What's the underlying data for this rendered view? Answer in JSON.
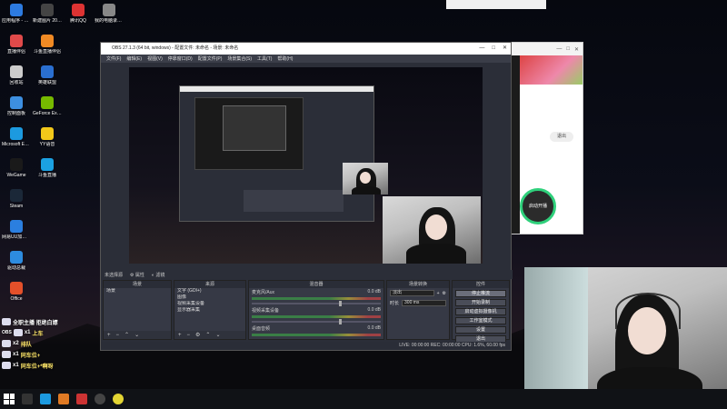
{
  "desktop": {
    "icons": [
      {
        "label": "应用程序 - 快捷方式",
        "color": "#2d7be0"
      },
      {
        "label": "新建图片 20210...",
        "color": "#444"
      },
      {
        "label": "腾讯QQ",
        "color": "#d33"
      },
      {
        "label": "我的电脑录屏 截屏",
        "color": "#888"
      },
      {
        "label": "直播伴侣",
        "color": "#e04a4a"
      },
      {
        "label": "斗鱼直播伴侣",
        "color": "#f08a24"
      },
      {
        "label": "回收站",
        "color": "#ccc"
      },
      {
        "label": "英雄联盟",
        "color": "#2a6fd0"
      },
      {
        "label": "控制面板",
        "color": "#3d8fe0"
      },
      {
        "label": "GeForce Experience",
        "color": "#76b900"
      },
      {
        "label": "Microsoft Edge",
        "color": "#1c9ae0"
      },
      {
        "label": "YY语音",
        "color": "#f2c81a"
      },
      {
        "label": "WeGame",
        "color": "#1a1a1a"
      },
      {
        "label": "斗鱼直播",
        "color": "#1ba1e2"
      },
      {
        "label": "Steam",
        "color": "#1b2838"
      },
      {
        "label": "网易UU加速器",
        "color": "#2b7fe0"
      },
      {
        "label": "驱动总裁",
        "color": "#2d8ce0"
      },
      {
        "label": "Office",
        "color": "#e3502a"
      }
    ]
  },
  "bg_app": {
    "close_label": "退出",
    "circle_label": "启动开播"
  },
  "obs": {
    "title": "OBS 27.1.3 (64 bit, windows) - 配置文件: 未命名 - 场景: 未命名",
    "menu": [
      "文件(F)",
      "编辑(E)",
      "视图(V)",
      "停靠窗口(D)",
      "配置文件(P)",
      "场景集合(S)",
      "工具(T)",
      "帮助(H)"
    ],
    "small_bar": {
      "no_source": "未选择源",
      "props": "属性",
      "filters": "滤镜"
    },
    "docks": {
      "scenes": {
        "title": "场景",
        "items": [
          "场景"
        ]
      },
      "sources": {
        "title": "来源",
        "items": [
          "文字 (GDI+)",
          "图像",
          "视频采集设备",
          "显示器采集"
        ]
      },
      "mixer": {
        "title": "混音器",
        "channels": [
          {
            "name": "麦克风/Aux",
            "db": "0.0 dB"
          },
          {
            "name": "视频采集设备",
            "db": "0.0 dB"
          },
          {
            "name": "桌面音频",
            "db": "0.0 dB"
          }
        ]
      },
      "transitions": {
        "title": "场景转换",
        "type": "淡出",
        "duration_label": "时长",
        "duration": "300 ms"
      },
      "controls": {
        "title": "控件",
        "buttons": [
          "停止推流",
          "开始录制",
          "启动虚拟摄像机",
          "工作室模式",
          "设置",
          "退出"
        ]
      }
    },
    "status": "LIVE: 00:00:00   REC: 00:00:00   CPU: 1.6%, 60.00 fps"
  },
  "overlay": {
    "header": "全职主播 拒绝白嫖",
    "lines": [
      {
        "user": "OBS",
        "count": "x1",
        "text": "上车"
      },
      {
        "user": "",
        "count": "x2",
        "text": "排队"
      },
      {
        "user": "",
        "count": "x1",
        "text": "同车位+"
      },
      {
        "user": "",
        "count": "x1",
        "text": "同车位+*啊呀"
      }
    ]
  }
}
